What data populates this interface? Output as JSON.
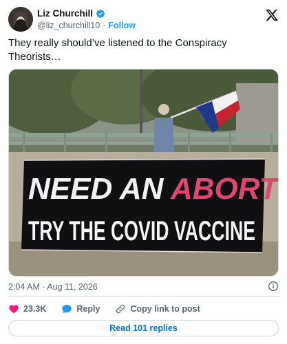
{
  "user": {
    "display_name": "Liz Churchill",
    "handle": "@liz_churchill10",
    "follow_label": "Follow",
    "separator": "·"
  },
  "tweet": {
    "text": "They really should’ve listened to the Conspiracy Theorists…",
    "timestamp": "2:04 AM · Aug 11, 2026"
  },
  "media": {
    "banner_line1_a": "NEED AN ",
    "banner_line1_b": "ABORTION?",
    "banner_line2": "TRY THE COVID VACCINE"
  },
  "actions": {
    "likes": "23.3K",
    "reply_label": "Reply",
    "copy_label": "Copy link to post"
  },
  "read_replies_label": "Read 101 replies",
  "colors": {
    "accent": "#1d9bf0",
    "like": "#f91880",
    "text": "#0f1419",
    "muted": "#536471"
  }
}
